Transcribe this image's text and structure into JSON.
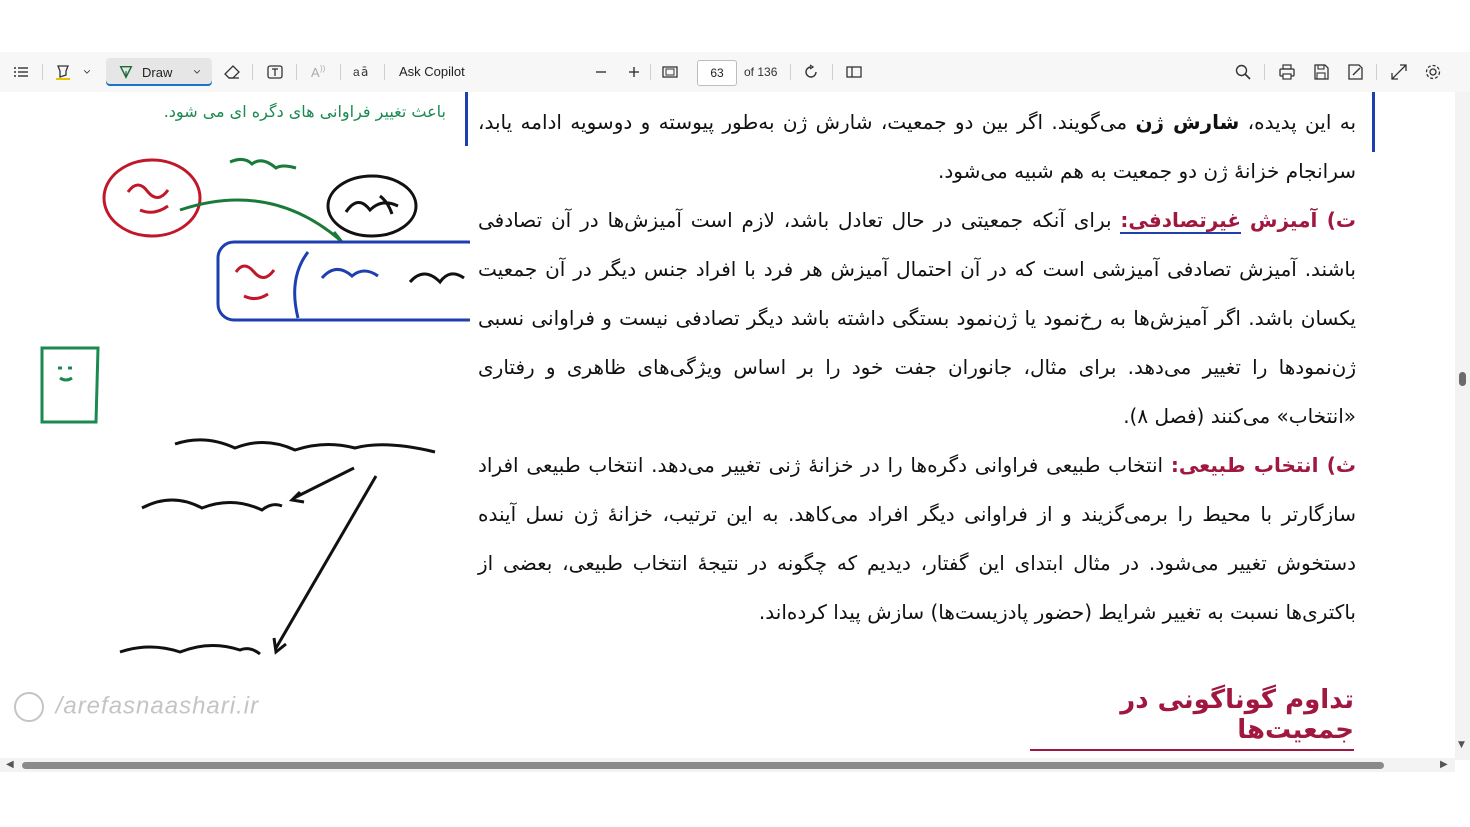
{
  "toolbar": {
    "draw_label": "Draw",
    "ask_copilot_label": "Ask Copilot",
    "page_number": "63",
    "page_total_label": "of 136"
  },
  "pdf": {
    "margin_note": "باعث تغییر فراوانی های دگره ای می شود.",
    "para1_a": "به این پدیده،",
    "para1_bold": "شارش ژن",
    "para1_b": "می‌گویند. اگر بین دو جمعیت، شارش ژن به‌طور پیوسته و دوسویه ادامه یابد، سرانجام خزانهٔ ژن دو جمعیت به هم شبیه می‌شود.",
    "para2_head1": "ت) آمیزش",
    "para2_head2": "غیرتصادفی:",
    "para2_body": "برای آنکه جمعیتی در حال تعادل باشد، لازم است آمیزش‌ها در آن تصادفی باشند. آمیزش تصادفی آمیزشی است که در آن احتمال آمیزش هر فرد با افراد جنس دیگر در آن جمعیت یکسان باشد. اگر آمیزش‌ها به رخ‌نمود یا ژن‌نمود بستگی داشته باشد دیگر تصادفی نیست و فراوانی نسبی ژن‌نمودها را تغییر می‌دهد. برای مثال، جانوران جفت خود را بر اساس ویژگی‌های ظاهری و رفتاری «انتخاب» می‌کنند (فصل ۸).",
    "para3_head": "ث) انتخاب طبیعی:",
    "para3_body": "انتخاب طبیعی فراوانی دگره‌ها را در خزانهٔ ژنی تغییر می‌دهد. انتخاب طبیعی افراد سازگارتر با محیط را برمی‌گزیند و از فراوانی دیگر افراد می‌کاهد. به این ترتیب، خزانهٔ ژن نسل آینده دستخوش تغییر می‌شود. در مثال ابتدای این گفتار، دیدیم که چگونه در نتیجهٔ انتخاب طبیعی، بعضی از باکتری‌ها نسبت به تغییر شرایط (حضور پادزیست‌ها) سازش پیدا کرده‌اند.",
    "section_title": "تداوم گوناگونی در جمعیت‌ها",
    "watermark": "/arefasnaashari.ir"
  },
  "colors": {
    "heading": "#a01840",
    "note_green": "#1a8a50",
    "ink_red": "#c0182a",
    "ink_blue": "#1d3fb0",
    "ink_black": "#111111"
  }
}
